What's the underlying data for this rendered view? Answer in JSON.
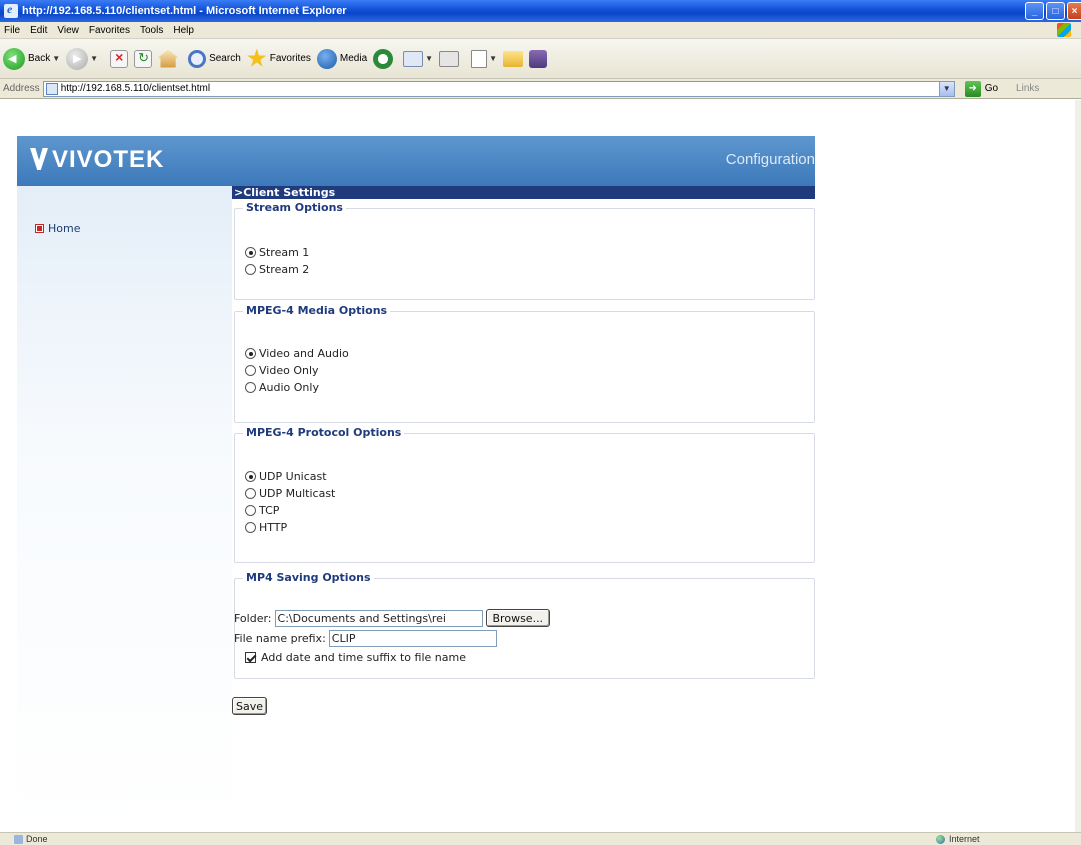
{
  "window": {
    "title": "http://192.168.5.110/clientset.html - Microsoft Internet Explorer"
  },
  "menu": [
    "File",
    "Edit",
    "View",
    "Favorites",
    "Tools",
    "Help"
  ],
  "toolbar": {
    "back_label": "Back",
    "search_label": "Search",
    "favorites_label": "Favorites",
    "media_label": "Media"
  },
  "address": {
    "label": "Address",
    "url": "http://192.168.5.110/clientset.html",
    "go_label": "Go",
    "links_label": "Links"
  },
  "header": {
    "brand": "VIVOTEK",
    "title": "Configuration"
  },
  "sidebar": {
    "home": "Home"
  },
  "client_settings": {
    "section_title": ">Client Settings",
    "stream": {
      "legend": "Stream Options",
      "options": [
        "Stream 1",
        "Stream 2"
      ],
      "selected": "Stream 1"
    },
    "media": {
      "legend": "MPEG-4 Media Options",
      "options": [
        "Video and Audio",
        "Video Only",
        "Audio Only"
      ],
      "selected": "Video and Audio"
    },
    "protocol": {
      "legend": "MPEG-4 Protocol Options",
      "options": [
        "UDP Unicast",
        "UDP Multicast",
        "TCP",
        "HTTP"
      ],
      "selected": "UDP Unicast"
    },
    "saving": {
      "legend": "MP4 Saving Options",
      "folder_label": "Folder:",
      "folder_value": "C:\\Documents and Settings\\rei",
      "browse_label": "Browse...",
      "prefix_label": "File name prefix:",
      "prefix_value": "CLIP",
      "suffix_label": "Add date and time suffix to file name",
      "suffix_checked": true
    },
    "save_label": "Save"
  },
  "status": {
    "text": "Done",
    "zone": "Internet"
  }
}
